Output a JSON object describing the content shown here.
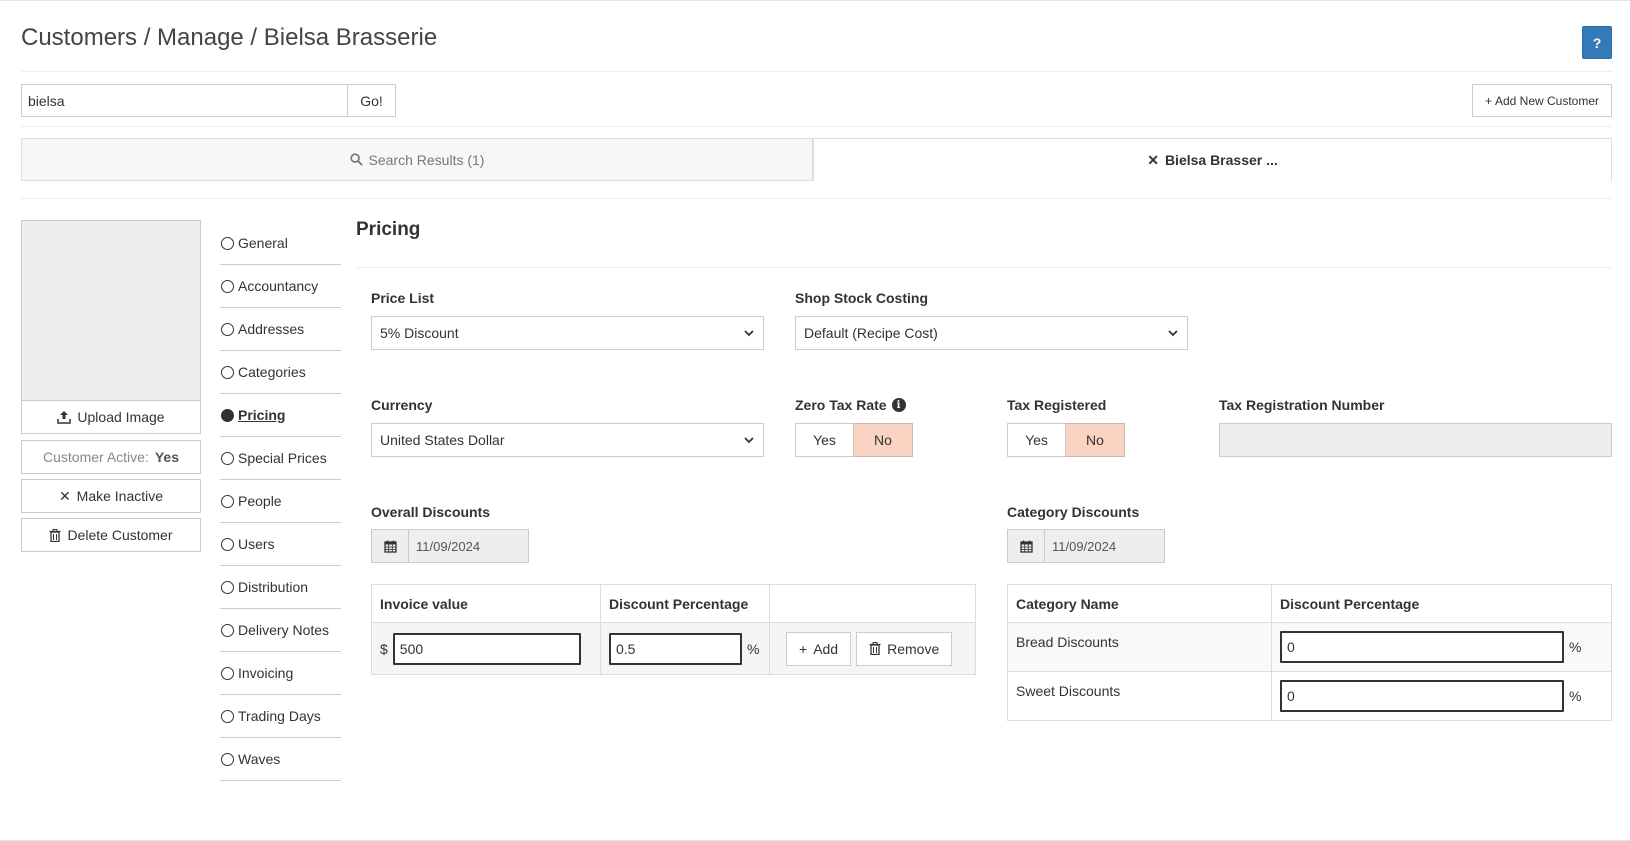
{
  "header": {
    "breadcrumb": "Customers / Manage / Bielsa Brasserie",
    "help_label": "?"
  },
  "search": {
    "value": "bielsa",
    "go_label": "Go!",
    "add_label": "Add New Customer"
  },
  "tabs": {
    "results_label": "Search Results (1)",
    "current_label": "Bielsa Brasser ..."
  },
  "sidebar": {
    "upload_label": "Upload Image",
    "active_label": "Customer Active:",
    "active_value": "Yes",
    "inactive_label": "Make Inactive",
    "delete_label": "Delete Customer"
  },
  "nav": {
    "items": [
      "General",
      "Accountancy",
      "Addresses",
      "Categories",
      "Pricing",
      "Special Prices",
      "People",
      "Users",
      "Distribution",
      "Delivery Notes",
      "Invoicing",
      "Trading Days",
      "Waves"
    ],
    "active": "Pricing"
  },
  "pricing": {
    "title": "Pricing",
    "price_list_label": "Price List",
    "price_list_value": "5% Discount",
    "stock_costing_label": "Shop Stock Costing",
    "stock_costing_value": "Default (Recipe Cost)",
    "currency_label": "Currency",
    "currency_value": "United States Dollar",
    "zero_tax_label": "Zero Tax Rate",
    "zero_tax_yes": "Yes",
    "zero_tax_no": "No",
    "zero_tax_selected": "No",
    "tax_registered_label": "Tax Registered",
    "tax_registered_yes": "Yes",
    "tax_registered_no": "No",
    "tax_registered_selected": "No",
    "tax_reg_number_label": "Tax Registration Number",
    "tax_reg_number_value": ""
  },
  "overall_discounts": {
    "label": "Overall Discounts",
    "date": "11/09/2024",
    "col_invoice": "Invoice value",
    "col_discount": "Discount Percentage",
    "currency_symbol": "$",
    "invoice_value": "500",
    "discount_value": "0.5",
    "percent_symbol": "%",
    "add_label": "Add",
    "remove_label": "Remove"
  },
  "category_discounts": {
    "label": "Category Discounts",
    "date": "11/09/2024",
    "col_name": "Category Name",
    "col_discount": "Discount Percentage",
    "percent_symbol": "%",
    "rows": [
      {
        "name": "Bread Discounts",
        "value": "0"
      },
      {
        "name": "Sweet Discounts",
        "value": "0"
      }
    ]
  },
  "colors": {
    "primary": "#337ab7",
    "selected_toggle": "#fad2c2",
    "readonly_bg": "#eeeeee"
  }
}
